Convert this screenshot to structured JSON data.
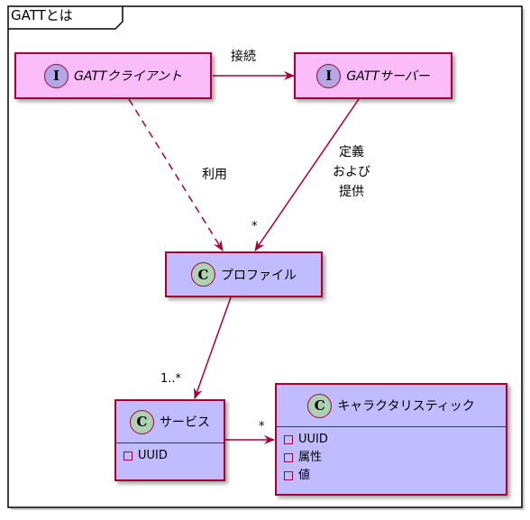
{
  "frame": {
    "title": "GATTとは"
  },
  "nodes": {
    "gatt_client": {
      "stereotype": "I",
      "name": "GATTクライアント"
    },
    "gatt_server": {
      "stereotype": "I",
      "name": "GATTサーバー"
    },
    "profile": {
      "stereotype": "C",
      "name": "プロファイル"
    },
    "service": {
      "stereotype": "C",
      "name": "サービス",
      "attributes": [
        "UUID"
      ]
    },
    "characteristic": {
      "stereotype": "C",
      "name": "キャラクタリスティック",
      "attributes": [
        "UUID",
        "属性",
        "値"
      ]
    }
  },
  "edges": {
    "connect_label": "接続",
    "use_label": "利用",
    "define_label": [
      "定義",
      "および",
      "提供"
    ],
    "server_profile_mult": "*",
    "profile_service_mult": "1..*",
    "service_char_mult": "*"
  },
  "colors": {
    "border": "#a80036",
    "interface_fill": "#fbbcfa",
    "class_fill": "#c0bcff",
    "interface_badge": "#b4a7e5",
    "class_badge": "#add1b2"
  }
}
